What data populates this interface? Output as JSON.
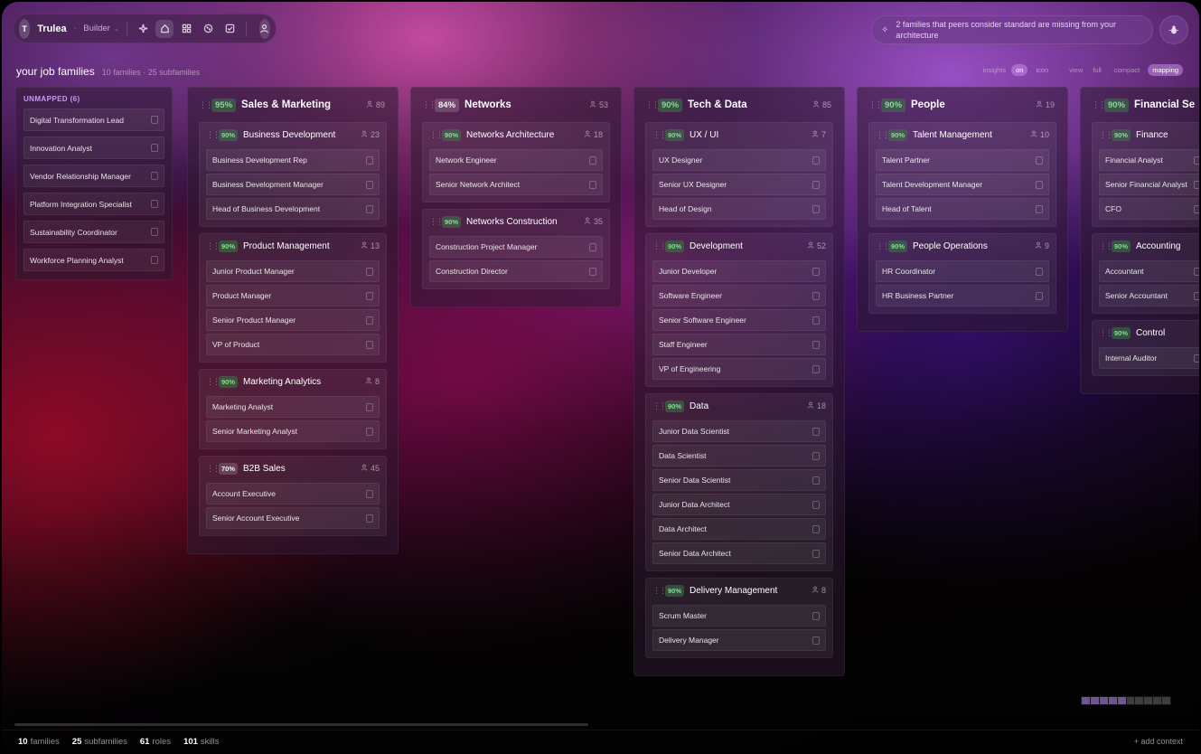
{
  "nav": {
    "avatar_letter": "T",
    "brand": "Trulea",
    "sep": "·",
    "mode": "Builder",
    "mode_chevron": "⌄",
    "icons": [
      "sparkle-icon",
      "home-icon",
      "grid-icon",
      "cookie-icon",
      "check-square-icon"
    ]
  },
  "insight": {
    "icon": "✧",
    "text": "2 families that peers consider standard are missing from your architecture"
  },
  "header": {
    "title": "your job families",
    "subtitle": "10 families · 25 subfamilies",
    "toggles": {
      "insights_label": "insights",
      "insights_on": "on",
      "insights_icon": "icon",
      "view_label": "view",
      "view_full": "full",
      "view_compact": "compact",
      "view_mapping": "mapping"
    }
  },
  "unmapped": {
    "heading": "UNMAPPED (6)",
    "roles": [
      "Digital Transformation Lead",
      "Innovation Analyst",
      "Vendor Relationship Manager",
      "Platform Integration Specialist",
      "Sustainability Coordinator",
      "Workforce Planning Analyst"
    ]
  },
  "families": [
    {
      "pct": "95%",
      "pct_style": "green",
      "name": "Sales & Marketing",
      "count": "89",
      "subfamilies": [
        {
          "pct": "90%",
          "pct_style": "green",
          "name": "Business Development",
          "count": "23",
          "roles": [
            "Business Development Rep",
            "Business Development Manager",
            "Head of Business Development"
          ]
        },
        {
          "pct": "90%",
          "pct_style": "green",
          "name": "Product Management",
          "count": "13",
          "roles": [
            "Junior Product Manager",
            "Product Manager",
            "Senior Product Manager",
            "VP of Product"
          ]
        },
        {
          "pct": "90%",
          "pct_style": "green",
          "name": "Marketing Analytics",
          "count": "8",
          "roles": [
            "Marketing Analyst",
            "Senior Marketing Analyst"
          ]
        },
        {
          "pct": "70%",
          "pct_style": "grey",
          "name": "B2B Sales",
          "count": "45",
          "roles": [
            "Account Executive",
            "Senior Account Executive"
          ]
        }
      ]
    },
    {
      "pct": "84%",
      "pct_style": "grey",
      "name": "Networks",
      "count": "53",
      "subfamilies": [
        {
          "pct": "90%",
          "pct_style": "green",
          "name": "Networks Architecture",
          "count": "18",
          "roles": [
            "Network Engineer",
            "Senior Network Architect"
          ]
        },
        {
          "pct": "90%",
          "pct_style": "green",
          "name": "Networks Construction",
          "count": "35",
          "roles": [
            "Construction Project Manager",
            "Construction Director"
          ]
        }
      ]
    },
    {
      "pct": "90%",
      "pct_style": "green",
      "name": "Tech & Data",
      "count": "85",
      "subfamilies": [
        {
          "pct": "90%",
          "pct_style": "green",
          "name": "UX / UI",
          "count": "7",
          "roles": [
            "UX Designer",
            "Senior UX Designer",
            "Head of Design"
          ]
        },
        {
          "pct": "90%",
          "pct_style": "green",
          "name": "Development",
          "count": "52",
          "roles": [
            "Junior Developer",
            "Software Engineer",
            "Senior Software Engineer",
            "Staff Engineer",
            "VP of Engineering"
          ]
        },
        {
          "pct": "90%",
          "pct_style": "green",
          "name": "Data",
          "count": "18",
          "roles": [
            "Junior Data Scientist",
            "Data Scientist",
            "Senior Data Scientist",
            "Junior Data Architect",
            "Data Architect",
            "Senior Data Architect"
          ]
        },
        {
          "pct": "90%",
          "pct_style": "green",
          "name": "Delivery Management",
          "count": "8",
          "roles": [
            "Scrum Master",
            "Delivery Manager"
          ]
        }
      ]
    },
    {
      "pct": "90%",
      "pct_style": "green",
      "name": "People",
      "count": "19",
      "subfamilies": [
        {
          "pct": "90%",
          "pct_style": "green",
          "name": "Talent Management",
          "count": "10",
          "roles": [
            "Talent Partner",
            "Talent Development Manager",
            "Head of Talent"
          ]
        },
        {
          "pct": "90%",
          "pct_style": "green",
          "name": "People Operations",
          "count": "9",
          "roles": [
            "HR Coordinator",
            "HR Business Partner"
          ]
        }
      ]
    },
    {
      "pct": "90%",
      "pct_style": "green",
      "name": "Financial Se",
      "count": "",
      "subfamilies": [
        {
          "pct": "90%",
          "pct_style": "green",
          "name": "Finance",
          "count": "",
          "roles": [
            "Financial Analyst",
            "Senior Financial Analyst",
            "CFO"
          ]
        },
        {
          "pct": "90%",
          "pct_style": "green",
          "name": "Accounting",
          "count": "",
          "roles": [
            "Accountant",
            "Senior Accountant"
          ]
        },
        {
          "pct": "90%",
          "pct_style": "green",
          "name": "Control",
          "count": "",
          "roles": [
            "Internal Auditor"
          ]
        }
      ]
    }
  ],
  "footer": {
    "families_n": "10",
    "families_l": "families",
    "subfamilies_n": "25",
    "subfamilies_l": "subfamilies",
    "roles_n": "61",
    "roles_l": "roles",
    "skills_n": "101",
    "skills_l": "skills",
    "add_context": "+ add context"
  }
}
